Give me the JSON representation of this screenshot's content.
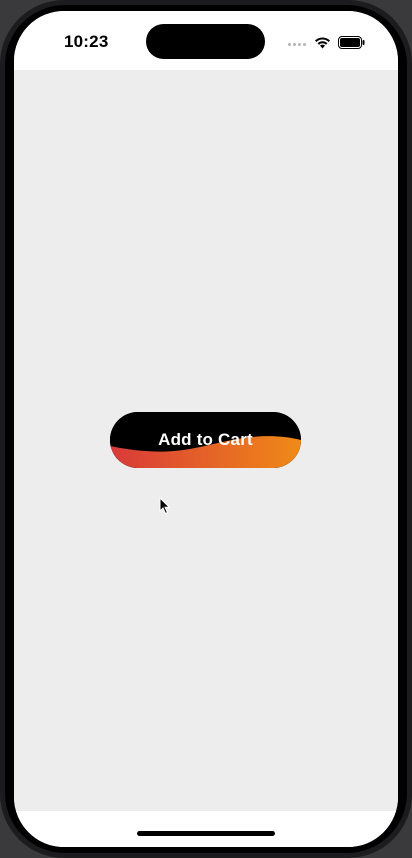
{
  "status_bar": {
    "time": "10:23",
    "signal_icon": "cellular-dots-icon",
    "wifi_icon": "wifi-icon",
    "battery_icon": "battery-icon"
  },
  "main": {
    "button_label": "Add to Cart",
    "button_colors": {
      "base": "#000000",
      "gradient_start": "#d8393a",
      "gradient_end": "#f08a16"
    },
    "background": "#ededed"
  },
  "pointer_icon": "mouse-cursor-icon",
  "home_indicator_icon": "home-indicator"
}
